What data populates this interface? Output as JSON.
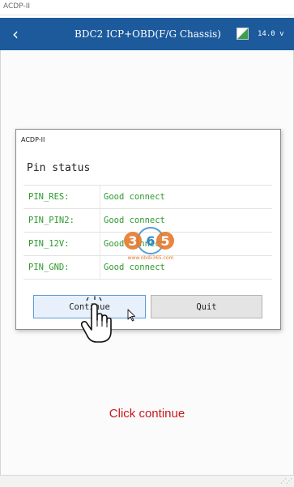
{
  "window": {
    "title": "ACDP-II"
  },
  "header": {
    "title": "BDC2 ICP+OBD(F/G Chassis)",
    "voltage": "14.0 v"
  },
  "dialog": {
    "title": "ACDP-II",
    "heading": "Pin status",
    "pins": [
      {
        "name": "PIN_RES:",
        "status": "Good connect"
      },
      {
        "name": "PIN_PIN2:",
        "status": "Good connect"
      },
      {
        "name": "PIN_12V:",
        "status": "Good connect"
      },
      {
        "name": "PIN_GND:",
        "status": "Good connect"
      }
    ],
    "buttons": {
      "continue": "Continue",
      "quit": "Quit"
    }
  },
  "caption": "Click continue",
  "watermark": {
    "text": "365",
    "url": "www.obdii365.com"
  },
  "colors": {
    "header_bg": "#1c5a9c",
    "pin_text": "#2f9a2f",
    "caption": "#c8181c",
    "continue_border": "#5d9ad6"
  },
  "icons": [
    "back-arrow-icon",
    "battery-icon",
    "hand-pointer-icon",
    "arrow-cursor-icon",
    "resize-grip-icon"
  ]
}
